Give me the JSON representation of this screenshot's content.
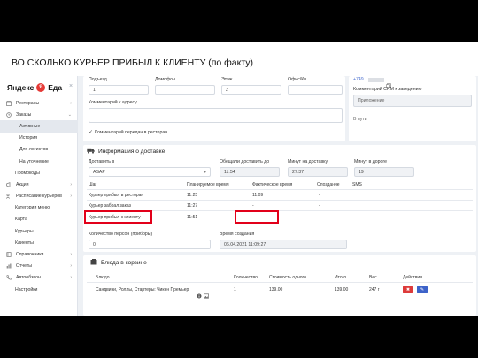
{
  "slide": {
    "title": "ВО СКОЛЬКО КУРЬЕР ПРИБЫЛ К КЛИЕНТУ (по факту)"
  },
  "logo": {
    "brand": "Яндекс",
    "letter": "Я",
    "product": "Еда",
    "collapse": "×"
  },
  "sidebar": {
    "items": [
      {
        "label": "Рестораны",
        "icon": "store-icon",
        "chev": "›"
      },
      {
        "label": "Заказы",
        "icon": "orders-icon",
        "chev": "⌄"
      },
      {
        "label": "Активные"
      },
      {
        "label": "История"
      },
      {
        "label": "Для логистов"
      },
      {
        "label": "На уточнение"
      },
      {
        "label": "Промокоды"
      },
      {
        "label": "Акции",
        "icon": "promo-icon",
        "chev": "›"
      },
      {
        "label": "Расписание курьеров",
        "icon": "schedule-icon",
        "chev": "›"
      },
      {
        "label": "Категории меню"
      },
      {
        "label": "Карта"
      },
      {
        "label": "Курьеры"
      },
      {
        "label": "Клиенты"
      },
      {
        "label": "Справочники",
        "icon": "book-icon",
        "chev": "›"
      },
      {
        "label": "Отчеты",
        "icon": "reports-icon",
        "chev": "›"
      },
      {
        "label": "Автообзвон",
        "icon": "phone-icon",
        "chev": "›"
      },
      {
        "label": "Настройки"
      }
    ]
  },
  "address": {
    "entrance_label": "Подъезд",
    "entrance_value": "1",
    "intercom_label": "Домофон",
    "intercom_value": "",
    "floor_label": "Этаж",
    "floor_value": "2",
    "office_label": "Офис/Кв.",
    "office_value": "",
    "comment_label": "Комментарий к адресу",
    "comment_value": "",
    "checkbox_label": "Комментарий передан в ресторан"
  },
  "right_panel": {
    "phone": "+749",
    "crm_label": "Комментарий CRM к заведению",
    "crm_value": "Приложение",
    "in_work": "В пути"
  },
  "delivery": {
    "title": "Информация о доставке",
    "deliver_label": "Доставить в",
    "deliver_value": "ASAP",
    "promised_label": "Обещали доставить до",
    "promised_value": "11:54",
    "minutes_delivery_label": "Минут на доставку",
    "minutes_delivery_value": "27:37",
    "minutes_road_label": "Минут в дороге",
    "minutes_road_value": "19",
    "columns": [
      "Шаг",
      "Планируемое время",
      "Фактическое время",
      "Опоздание",
      "SMS"
    ],
    "rows": [
      {
        "step": "Курьер прибыл в ресторан",
        "planned": "11:25",
        "actual": "11:09",
        "late": "-"
      },
      {
        "step": "Курьер забрал заказ",
        "planned": "11:27",
        "actual": "-",
        "late": "-"
      },
      {
        "step": "Курьер прибыл к клиенту",
        "planned": "11:51",
        "actual": "-",
        "late": "-"
      }
    ],
    "persons_label": "Количество персон (приборы)",
    "persons_value": "0",
    "created_label": "Время создания",
    "created_value": "06.04.2021 11:09:27"
  },
  "cart": {
    "title": "Блюда в корзине",
    "columns": [
      "Блюдо",
      "Количество",
      "Стоимость одного",
      "Итого",
      "Вес",
      "Действия"
    ],
    "rows": [
      {
        "dish": "Сандвичи, Роллы, Стартеры: Чикен Премьер",
        "qty": "1",
        "price": "139.00",
        "total": "139.00",
        "weight": "247 г"
      }
    ],
    "delete_glyph": "✖",
    "edit_glyph": "✎"
  },
  "colors": {
    "highlight": "#e2001a",
    "logo_red": "#e53935",
    "delete": "#dd3a3a",
    "edit": "#3d63c9"
  }
}
